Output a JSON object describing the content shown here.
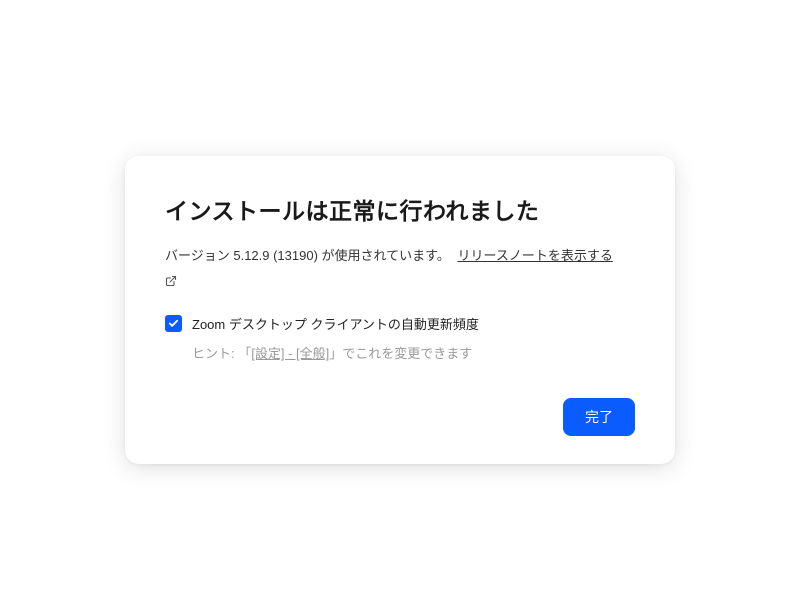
{
  "dialog": {
    "title": "インストールは正常に行われました",
    "version_text": "バージョン 5.12.9 (13190) が使用されています。",
    "release_notes_link": "リリースノートを表示する",
    "checkbox_label": "Zoom デスクトップ クライアントの自動更新頻度",
    "checkbox_checked": true,
    "hint_prefix": "ヒント: 「",
    "hint_link": "[設定] - [全般]",
    "hint_suffix": "」でこれを変更できます",
    "done_button": "完了"
  }
}
